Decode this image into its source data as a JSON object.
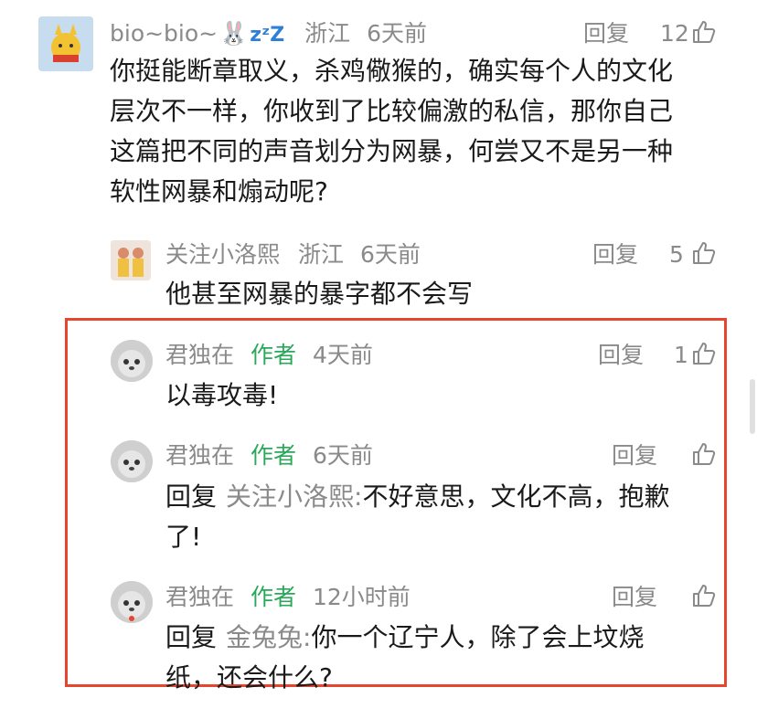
{
  "comments": [
    {
      "user": "bio~bio~",
      "user_emoji": "🐰",
      "sleep_icon": "zzz-icon",
      "location": "浙江",
      "time": "6天前",
      "reply_label": "回复",
      "likes": "12",
      "lines": [
        "你挺能断章取义，杀鸡儆猴的，确实每个人的文化",
        "层次不一样，你收到了比较偏激的私信，那你自己",
        "这篇把不同的声音划分为网暴，何尝又不是另一种",
        "软性网暴和煽动呢?"
      ]
    },
    {
      "user": "关注小洛熙",
      "location": "浙江",
      "time": "6天前",
      "reply_label": "回复",
      "likes": "5",
      "lines": [
        "他甚至网暴的暴字都不会写"
      ]
    },
    {
      "user": "君独在",
      "author_tag": "作者",
      "time": "4天前",
      "reply_label": "回复",
      "likes": "1",
      "lines": [
        "以毒攻毒!"
      ]
    },
    {
      "user": "君独在",
      "author_tag": "作者",
      "time": "6天前",
      "reply_label": "回复",
      "likes": "",
      "reply_prefix": "回复",
      "reply_to": "关注小洛熙:",
      "lines": [
        "不好意思，文化不高，抱歉",
        "了!"
      ]
    },
    {
      "user": "君独在",
      "author_tag": "作者",
      "time": "12小时前",
      "reply_label": "回复",
      "likes": "",
      "reply_prefix": "回复",
      "reply_to": "金兔兔:",
      "lines": [
        "你一个辽宁人，除了会上坟烧",
        "纸，还会什么?"
      ]
    }
  ],
  "highlight_color": "#e8452e",
  "author_color": "#2aa85a"
}
